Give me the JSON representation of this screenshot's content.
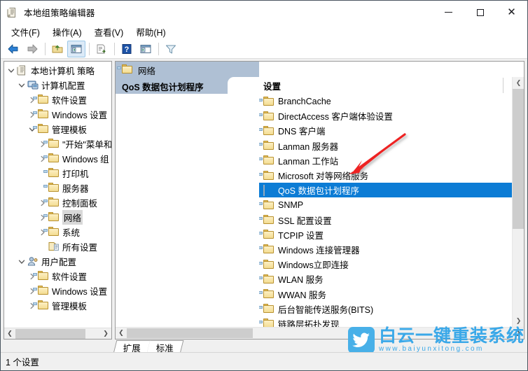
{
  "window": {
    "title": "本地组策略编辑器",
    "icon": "policy-document-icon",
    "minimize_label": "最小化",
    "maximize_label": "最大化",
    "close_label": "关闭"
  },
  "menu": [
    {
      "label": "文件(F)",
      "name": "menu-file"
    },
    {
      "label": "操作(A)",
      "name": "menu-action"
    },
    {
      "label": "查看(V)",
      "name": "menu-view"
    },
    {
      "label": "帮助(H)",
      "name": "menu-help"
    }
  ],
  "toolbar": [
    {
      "name": "back-icon",
      "label": "后退"
    },
    {
      "name": "forward-icon",
      "label": "前进"
    },
    {
      "name": "up-folder-icon",
      "label": "上移一级"
    },
    {
      "name": "show-hide-tree-icon",
      "label": "显示/隐藏控制台树"
    },
    {
      "name": "export-list-icon",
      "label": "导出列表"
    },
    {
      "name": "help-icon",
      "label": "帮助"
    },
    {
      "name": "properties-icon",
      "label": "属性"
    },
    {
      "name": "filter-icon",
      "label": "筛选器"
    }
  ],
  "tree": [
    {
      "label": "本地计算机 策略",
      "indent": 0,
      "twist": "expanded",
      "icon": "policy-document-icon",
      "selected": false
    },
    {
      "label": "计算机配置",
      "indent": 1,
      "twist": "expanded",
      "icon": "computer-icon",
      "selected": false
    },
    {
      "label": "软件设置",
      "indent": 2,
      "twist": "collapsed",
      "icon": "folder-icon",
      "selected": false
    },
    {
      "label": "Windows 设置",
      "indent": 2,
      "twist": "collapsed",
      "icon": "folder-icon",
      "selected": false
    },
    {
      "label": "管理模板",
      "indent": 2,
      "twist": "expanded",
      "icon": "folder-icon",
      "selected": false
    },
    {
      "label": "\"开始\"菜单和",
      "indent": 3,
      "twist": "collapsed",
      "icon": "folder-icon",
      "selected": false
    },
    {
      "label": "Windows 组",
      "indent": 3,
      "twist": "collapsed",
      "icon": "folder-icon",
      "selected": false
    },
    {
      "label": "打印机",
      "indent": 3,
      "twist": "none",
      "icon": "folder-icon",
      "selected": false
    },
    {
      "label": "服务器",
      "indent": 3,
      "twist": "none",
      "icon": "folder-icon",
      "selected": false
    },
    {
      "label": "控制面板",
      "indent": 3,
      "twist": "collapsed",
      "icon": "folder-icon",
      "selected": false
    },
    {
      "label": "网络",
      "indent": 3,
      "twist": "collapsed",
      "icon": "folder-icon",
      "selected": true
    },
    {
      "label": "系统",
      "indent": 3,
      "twist": "collapsed",
      "icon": "folder-icon",
      "selected": false
    },
    {
      "label": "所有设置",
      "indent": 3,
      "twist": "none",
      "icon": "all-settings-icon",
      "selected": false
    },
    {
      "label": "用户配置",
      "indent": 1,
      "twist": "expanded",
      "icon": "user-icon",
      "selected": false
    },
    {
      "label": "软件设置",
      "indent": 2,
      "twist": "collapsed",
      "icon": "folder-icon",
      "selected": false
    },
    {
      "label": "Windows 设置",
      "indent": 2,
      "twist": "collapsed",
      "icon": "folder-icon",
      "selected": false
    },
    {
      "label": "管理模板",
      "indent": 2,
      "twist": "collapsed",
      "icon": "folder-icon",
      "selected": false
    }
  ],
  "results": {
    "header_title": "网络",
    "header_icon": "folder-icon",
    "subtitle": "QoS 数据包计划程序",
    "column_header": "设置",
    "items": [
      {
        "label": "BranchCache",
        "icon": "folder-icon",
        "selected": false
      },
      {
        "label": "DirectAccess 客户端体验设置",
        "icon": "folder-icon",
        "selected": false
      },
      {
        "label": "DNS 客户端",
        "icon": "folder-icon",
        "selected": false
      },
      {
        "label": "Lanman 服务器",
        "icon": "folder-icon",
        "selected": false
      },
      {
        "label": "Lanman 工作站",
        "icon": "folder-icon",
        "selected": false
      },
      {
        "label": "Microsoft 对等网络服务",
        "icon": "folder-icon",
        "selected": false
      },
      {
        "label": "QoS 数据包计划程序",
        "icon": "checkered-icon",
        "selected": true
      },
      {
        "label": "SNMP",
        "icon": "folder-icon",
        "selected": false
      },
      {
        "label": "SSL 配置设置",
        "icon": "folder-icon",
        "selected": false
      },
      {
        "label": "TCPIP 设置",
        "icon": "folder-icon",
        "selected": false
      },
      {
        "label": "Windows 连接管理器",
        "icon": "folder-icon",
        "selected": false
      },
      {
        "label": "Windows立即连接",
        "icon": "folder-icon",
        "selected": false
      },
      {
        "label": "WLAN 服务",
        "icon": "folder-icon",
        "selected": false
      },
      {
        "label": "WWAN 服务",
        "icon": "folder-icon",
        "selected": false
      },
      {
        "label": "后台智能传送服务(BITS)",
        "icon": "folder-icon",
        "selected": false
      },
      {
        "label": "链路层拓扑发现",
        "icon": "folder-icon",
        "selected": false
      }
    ]
  },
  "tabs": [
    {
      "label": "扩展",
      "name": "tab-extended",
      "active": false
    },
    {
      "label": "标准",
      "name": "tab-standard",
      "active": true
    }
  ],
  "statusbar": {
    "text": "1 个设置"
  },
  "watermark": {
    "brand": "白云一键重装系统",
    "url": "www.baiyunxitong.com",
    "logo_icon": "twitter-bird-icon",
    "color": "#3aa8e8"
  },
  "annotation": {
    "type": "red-arrow",
    "color": "#ee2222"
  },
  "colors": {
    "selection": "#0c7cd5",
    "header_band": "#afc0d4",
    "window_border": "#4a5560"
  }
}
